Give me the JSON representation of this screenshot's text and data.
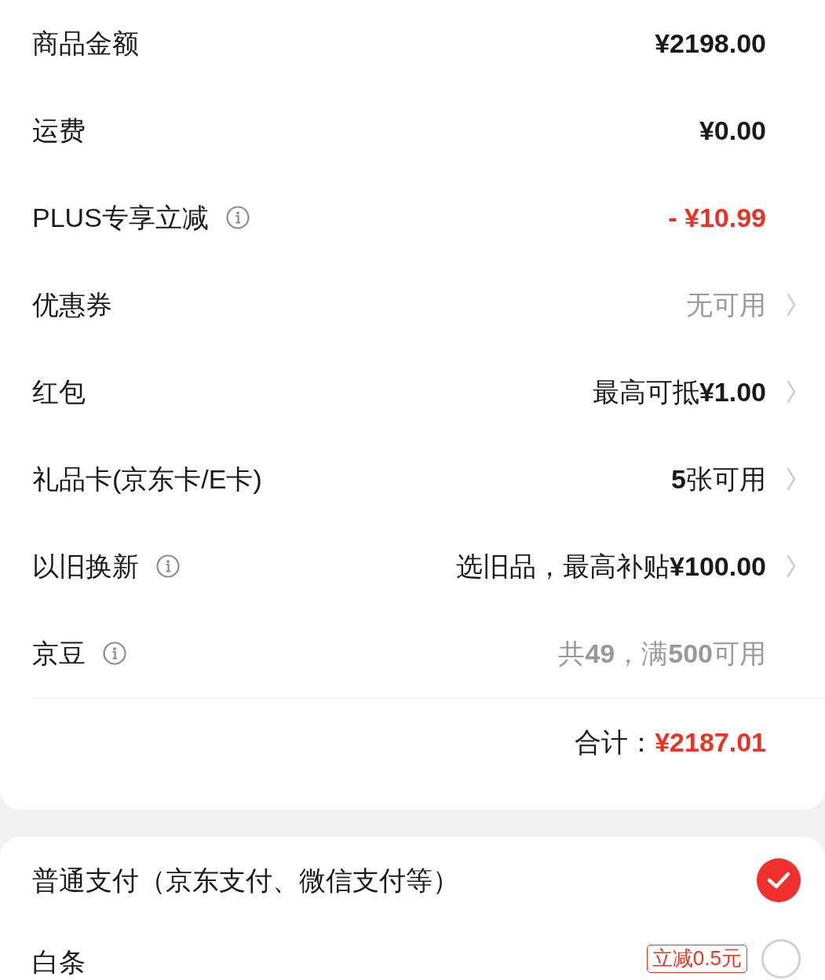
{
  "summary": {
    "rows": [
      {
        "kind": "price",
        "label": "商品金额",
        "info": false,
        "value": "¥2198.00",
        "chevron": false
      },
      {
        "kind": "price",
        "label": "运费",
        "info": false,
        "value": "¥0.00",
        "chevron": false
      },
      {
        "kind": "discount",
        "label": "PLUS专享立减",
        "info": true,
        "value": "- ¥10.99",
        "chevron": false
      },
      {
        "kind": "hint",
        "label": "优惠券",
        "info": false,
        "value": "无可用",
        "chevron": true
      },
      {
        "kind": "offer",
        "label": "红包",
        "info": false,
        "value": "最高可抵**¥1.00**",
        "chevron": true
      },
      {
        "kind": "offer",
        "label": "礼品卡(京东卡/E卡)",
        "info": false,
        "value": "**5**张可用",
        "chevron": true
      },
      {
        "kind": "offer",
        "label": "以旧换新",
        "info": true,
        "value": "选旧品，最高补贴**¥100.00**",
        "chevron": true
      },
      {
        "kind": "hint",
        "label": "京豆",
        "info": true,
        "value": "共**49**，满**500**可用",
        "chevron": false
      }
    ],
    "total": {
      "label": "合计：",
      "value": "¥2187.01"
    }
  },
  "payment": {
    "options": [
      {
        "label": "普通支付（京东支付、微信支付等）",
        "selected": true
      },
      {
        "label": "白条",
        "badge": "立减0.5元",
        "selected": false
      }
    ]
  }
}
